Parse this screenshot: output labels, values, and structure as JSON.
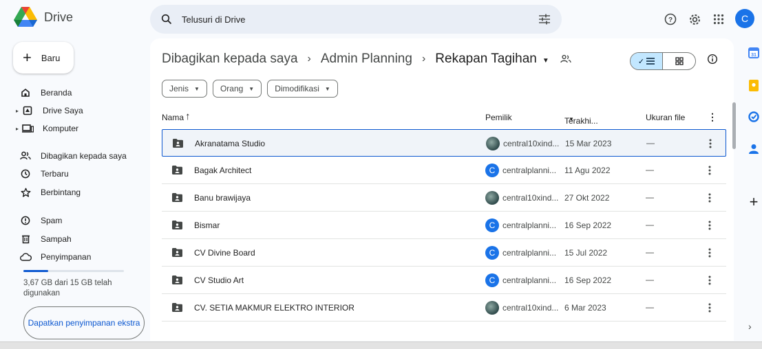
{
  "app": {
    "title": "Drive"
  },
  "search": {
    "placeholder": "Telusuri di Drive",
    "value": ""
  },
  "user": {
    "initial": "C"
  },
  "sidebar": {
    "new_label": "Baru",
    "items": [
      {
        "label": "Beranda",
        "icon": "home-icon"
      },
      {
        "label": "Drive Saya",
        "icon": "my-drive-icon"
      },
      {
        "label": "Komputer",
        "icon": "computer-icon"
      },
      {
        "label": "Dibagikan kepada saya",
        "icon": "shared-icon"
      },
      {
        "label": "Terbaru",
        "icon": "clock-icon"
      },
      {
        "label": "Berbintang",
        "icon": "star-icon"
      },
      {
        "label": "Spam",
        "icon": "spam-icon"
      },
      {
        "label": "Sampah",
        "icon": "trash-icon"
      },
      {
        "label": "Penyimpanan",
        "icon": "cloud-icon"
      }
    ],
    "storage_used_fraction": 0.245,
    "storage_text": "3,67 GB dari 15 GB telah digunakan",
    "get_storage_label": "Dapatkan penyimpanan ekstra"
  },
  "breadcrumb": {
    "items": [
      "Dibagikan kepada saya",
      "Admin Planning",
      "Rekapan Tagihan"
    ],
    "separator": "›"
  },
  "filters": {
    "type": "Jenis",
    "people": "Orang",
    "modified": "Dimodifikasi"
  },
  "table": {
    "columns": {
      "name": "Nama",
      "owner": "Pemilik",
      "modified": "Terakhi...",
      "size": "Ukuran file"
    },
    "rows": [
      {
        "name": "Akranatama Studio",
        "owner": "central10xind...",
        "avatar": "photo",
        "date": "15 Mar 2023",
        "size": "—",
        "selected": true
      },
      {
        "name": "Bagak Architect",
        "owner": "centralplanni...",
        "avatar": "C",
        "date": "11 Agu 2022",
        "size": "—"
      },
      {
        "name": "Banu brawijaya",
        "owner": "central10xind...",
        "avatar": "photo",
        "date": "27 Okt 2022",
        "size": "—"
      },
      {
        "name": "Bismar",
        "owner": "centralplanni...",
        "avatar": "C",
        "date": "16 Sep 2022",
        "size": "—"
      },
      {
        "name": "CV Divine Board",
        "owner": "centralplanni...",
        "avatar": "C",
        "date": "15 Jul 2022",
        "size": "—"
      },
      {
        "name": "CV Studio Art",
        "owner": "centralplanni...",
        "avatar": "C",
        "date": "16 Sep 2022",
        "size": "—"
      },
      {
        "name": "CV. SETIA MAKMUR ELEKTRO INTERIOR",
        "owner": "central10xind...",
        "avatar": "photo",
        "date": "6 Mar 2023",
        "size": "—"
      }
    ]
  },
  "colors": {
    "accent": "#0b57d0",
    "selected_bg": "#c2e7ff",
    "background": "#f8fafd"
  }
}
